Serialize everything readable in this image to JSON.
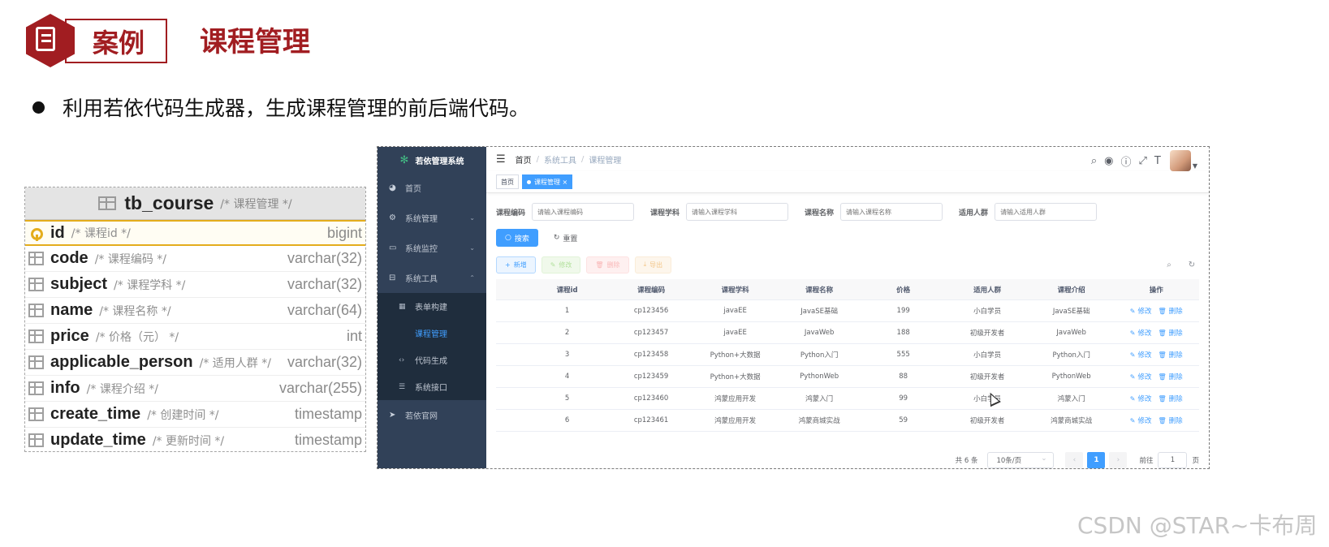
{
  "slide": {
    "case_label": "案例",
    "title": "课程管理",
    "bullet": "利用若依代码生成器，生成课程管理的前后端代码。",
    "watermark": "CSDN @STAR~卡布周"
  },
  "db_table": {
    "name": "tb_course",
    "comment": "/* 课程管理 */",
    "columns": [
      {
        "name": "id",
        "comment": "/* 课程id */",
        "type": "bigint",
        "pk": true
      },
      {
        "name": "code",
        "comment": "/* 课程编码 */",
        "type": "varchar(32)"
      },
      {
        "name": "subject",
        "comment": "/* 课程学科 */",
        "type": "varchar(32)"
      },
      {
        "name": "name",
        "comment": "/* 课程名称 */",
        "type": "varchar(64)"
      },
      {
        "name": "price",
        "comment": "/* 价格（元） */",
        "type": "int"
      },
      {
        "name": "applicable_person",
        "comment": "/* 适用人群 */",
        "type": "varchar(32)"
      },
      {
        "name": "info",
        "comment": "/* 课程介绍 */",
        "type": "varchar(255)"
      },
      {
        "name": "create_time",
        "comment": "/* 创建时间 */",
        "type": "timestamp"
      },
      {
        "name": "update_time",
        "comment": "/* 更新时间 */",
        "type": "timestamp"
      }
    ]
  },
  "app": {
    "system_name": "若依管理系统",
    "colors": {
      "sidebar": "#314158",
      "submenu": "#1f2d3d",
      "primary": "#409eff",
      "brand": "#a11d21"
    },
    "menu": {
      "home": "首页",
      "system": "系统管理",
      "monitor": "系统监控",
      "tools": "系统工具",
      "form_build": "表单构建",
      "course": "课程管理",
      "codegen": "代码生成",
      "api": "系统接口",
      "website": "若依官网"
    },
    "breadcrumb": [
      "首页",
      "系统工具",
      "课程管理"
    ],
    "tags": {
      "home": "首页",
      "course": "课程管理 ×"
    },
    "search": {
      "code_label": "课程编码",
      "code_placeholder": "请输入课程编码",
      "subject_label": "课程学科",
      "subject_placeholder": "请输入课程学科",
      "name_label": "课程名称",
      "name_placeholder": "请输入课程名称",
      "person_label": "适用人群",
      "person_placeholder": "请输入适用人群",
      "search_btn": "搜索",
      "reset_btn": "重置"
    },
    "ops": {
      "add": "新增",
      "edit": "修改",
      "delete": "删除",
      "export": "导出"
    },
    "table": {
      "headers": [
        "课程id",
        "课程编码",
        "课程学科",
        "课程名称",
        "价格",
        "适用人群",
        "课程介绍",
        "操作"
      ],
      "edit_label": "修改",
      "delete_label": "删除",
      "rows": [
        {
          "id": "1",
          "code": "cp123456",
          "subject": "javaEE",
          "name": "JavaSE基础",
          "price": "199",
          "person": "小白学员",
          "info": "JavaSE基础"
        },
        {
          "id": "2",
          "code": "cp123457",
          "subject": "javaEE",
          "name": "JavaWeb",
          "price": "188",
          "person": "初级开发者",
          "info": "JavaWeb"
        },
        {
          "id": "3",
          "code": "cp123458",
          "subject": "Python+大数据",
          "name": "Python入门",
          "price": "555",
          "person": "小白学员",
          "info": "Python入门"
        },
        {
          "id": "4",
          "code": "cp123459",
          "subject": "Python+大数据",
          "name": "PythonWeb",
          "price": "88",
          "person": "初级开发者",
          "info": "PythonWeb"
        },
        {
          "id": "5",
          "code": "cp123460",
          "subject": "鸿蒙应用开发",
          "name": "鸿蒙入门",
          "price": "99",
          "person": "小白学员",
          "info": "鸿蒙入门"
        },
        {
          "id": "6",
          "code": "cp123461",
          "subject": "鸿蒙应用开发",
          "name": "鸿蒙商城实战",
          "price": "59",
          "person": "初级开发者",
          "info": "鸿蒙商城实战"
        }
      ]
    },
    "pagination": {
      "total": "共 6 条",
      "page_size": "10条/页",
      "current": "1",
      "goto": "前往",
      "goto_value": "1",
      "page_unit": "页"
    }
  }
}
